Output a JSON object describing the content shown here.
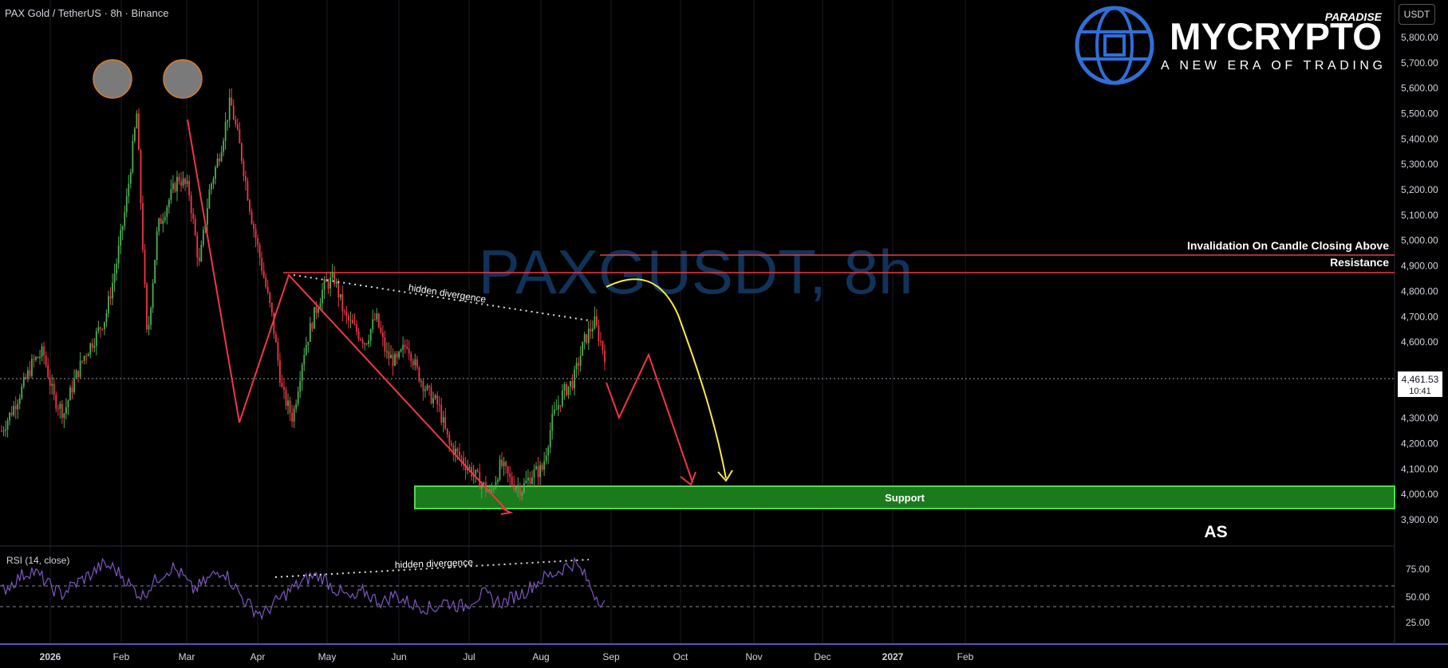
{
  "header": {
    "symbol_title": "PAX Gold / TetherUS · 8h · Binance"
  },
  "currency_button": "USDT",
  "watermark": "PAXGUSDT, 8h",
  "logo": {
    "brand": "MYCRYPTO",
    "tag": "PARADISE",
    "slogan": "A NEW ERA OF TRADING"
  },
  "last_price": {
    "value": "4,461.53",
    "countdown": "10:41",
    "price": 4461.53
  },
  "annotations": {
    "invalidation": "Invalidation On Candle Closing Above",
    "resistance": "Resistance",
    "support": "Support",
    "hidden_div_price": "hidden divergence",
    "hidden_div_rsi": "hidden divergence",
    "author": "AS"
  },
  "rsi_panel": {
    "label": "RSI (14, close)"
  },
  "chart_data": [
    {
      "type": "line",
      "title": "PAX Gold / TetherUS · 8h · Binance",
      "y_ticks": [
        5800,
        5700,
        5600,
        5500,
        5400,
        5300,
        5200,
        5100,
        5000,
        4900,
        4800,
        4700,
        4600,
        4300,
        4200,
        4100,
        4000,
        3900
      ],
      "y_tick_labels": [
        "5,800.00",
        "5,700.00",
        "5,600.00",
        "5,500.00",
        "5,400.00",
        "5,300.00",
        "5,200.00",
        "5,100.00",
        "5,000.00",
        "4,900.00",
        "4,800.00",
        "4,700.00",
        "4,600.00",
        "4,300.00",
        "4,200.00",
        "4,100.00",
        "4,000.00",
        "3,900.00"
      ],
      "x_labels": [
        "2026",
        "Feb",
        "Mar",
        "Apr",
        "May",
        "Jun",
        "Jul",
        "Aug",
        "Sep",
        "Oct",
        "Nov",
        "Dec",
        "2027",
        "Feb"
      ],
      "ylim": [
        3850,
        5850
      ],
      "series": [
        {
          "values": [
            4250,
            4330,
            4420,
            4520,
            4560,
            4380,
            4320,
            4450,
            4550,
            4620,
            4700,
            4900,
            5150,
            5500,
            4600,
            5050,
            5150,
            5250,
            5200,
            4900,
            5200,
            5350,
            5550,
            5350,
            5100,
            4900,
            4700,
            4400,
            4300,
            4550,
            4700,
            4820,
            4850,
            4700,
            4650,
            4600,
            4700,
            4550,
            4520,
            4600,
            4480,
            4400,
            4350,
            4200,
            4150,
            4100,
            4050,
            4000,
            4120,
            4050,
            4020,
            4080,
            4100,
            4300,
            4400,
            4450,
            4600,
            4680,
            4550
          ]
        }
      ],
      "levels": {
        "invalidation": 4950,
        "resistance": 4880,
        "support_band": [
          3965,
          4040
        ],
        "current_price": 4461.53
      },
      "projection_path": [
        4650,
        4330,
        4560,
        4050
      ]
    },
    {
      "type": "line",
      "title": "RSI (14, close)",
      "y_ticks": [
        75,
        50,
        25
      ],
      "y_tick_labels": [
        "75.00",
        "50.00",
        "25.00"
      ],
      "ylim": [
        15,
        95
      ],
      "hlines": [
        60,
        40
      ],
      "series": [
        {
          "values": [
            55,
            62,
            70,
            75,
            68,
            58,
            52,
            60,
            66,
            72,
            80,
            78,
            70,
            58,
            50,
            62,
            72,
            78,
            70,
            56,
            62,
            70,
            76,
            62,
            48,
            38,
            32,
            42,
            50,
            58,
            64,
            70,
            68,
            58,
            52,
            46,
            55,
            48,
            44,
            52,
            46,
            42,
            40,
            38,
            45,
            42,
            40,
            48,
            52,
            46,
            44,
            50,
            54,
            62,
            68,
            72,
            78,
            82,
            70,
            52,
            42
          ]
        }
      ]
    }
  ],
  "colors": {
    "up": "#26a69a",
    "bull_candle": "#4caf50",
    "bear_candle": "#f23645",
    "rsi_line": "#7e57c2",
    "support": "#4caf50",
    "resistance": "#f23645",
    "projection_yellow": "#ffeb3b"
  }
}
